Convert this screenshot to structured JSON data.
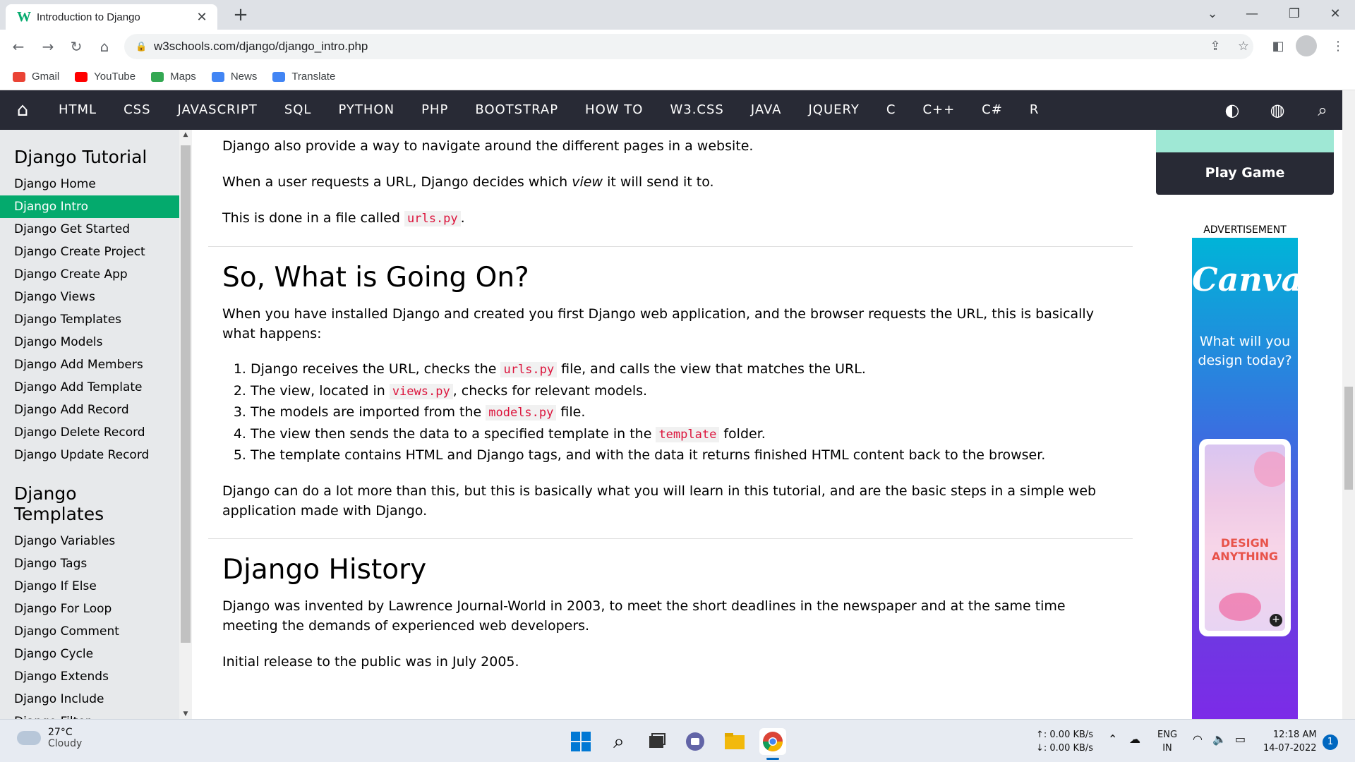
{
  "browser": {
    "tab_title": "Introduction to Django",
    "tab_favicon": "W",
    "url": "w3schools.com/django/django_intro.php"
  },
  "bookmarks": [
    {
      "label": "Gmail",
      "color": "#ea4335"
    },
    {
      "label": "YouTube",
      "color": "#ff0000"
    },
    {
      "label": "Maps",
      "color": "#34a853"
    },
    {
      "label": "News",
      "color": "#4285f4"
    },
    {
      "label": "Translate",
      "color": "#4285f4"
    }
  ],
  "topnav": {
    "items": [
      "HTML",
      "CSS",
      "JAVASCRIPT",
      "SQL",
      "PYTHON",
      "PHP",
      "BOOTSTRAP",
      "HOW TO",
      "W3.CSS",
      "JAVA",
      "JQUERY",
      "C",
      "C++",
      "C#",
      "R"
    ]
  },
  "sidebar": {
    "section1_title": "Django Tutorial",
    "section1_items": [
      "Django Home",
      "Django Intro",
      "Django Get Started",
      "Django Create Project",
      "Django Create App",
      "Django Views",
      "Django Templates",
      "Django Models",
      "Django Add Members",
      "Django Add Template",
      "Django Add Record",
      "Django Delete Record",
      "Django Update Record"
    ],
    "active_item": "Django Intro",
    "section2_title": "Django Templates",
    "section2_items": [
      "Django Variables",
      "Django Tags",
      "Django If Else",
      "Django For Loop",
      "Django Comment",
      "Django Cycle",
      "Django Extends",
      "Django Include",
      "Django Filter"
    ]
  },
  "main": {
    "p1": "Django also provide a way to navigate around the different pages in a website.",
    "p2_a": "When a user requests a URL, Django decides which ",
    "p2_em": "view",
    "p2_b": " it will send it to.",
    "p3_a": "This is done in a file called ",
    "p3_code": "urls.py",
    "p3_b": ".",
    "h2_going_on": "So, What is Going On?",
    "p4": "When you have installed Django and created you first Django web application, and the browser requests the URL, this is basically what happens:",
    "list": [
      {
        "a": "Django receives the URL, checks the ",
        "code": "urls.py",
        "b": " file, and calls the view that matches the URL."
      },
      {
        "a": "The view, located in ",
        "code": "views.py",
        "b": ", checks for relevant models."
      },
      {
        "a": "The models are imported from the ",
        "code": "models.py",
        "b": " file."
      },
      {
        "a": "The view then sends the data to a specified template in the ",
        "code": "template",
        "b": " folder."
      },
      {
        "a": "The template contains HTML and Django tags, and with the data it returns finished HTML content back to the browser.",
        "code": "",
        "b": ""
      }
    ],
    "p5": "Django can do a lot more than this, but this is basically what you will learn in this tutorial, and are the basic steps in a simple web application made with Django.",
    "h2_history": "Django History",
    "p6": "Django was invented by Lawrence Journal-World in 2003, to meet the short deadlines in the newspaper and at the same time meeting the demands of experienced web developers.",
    "p7": "Initial release to the public was in July 2005."
  },
  "right": {
    "play_button": "Play Game",
    "ad_label": "ADVERTISEMENT",
    "ad_logo": "Canva",
    "ad_tagline": "What will you design today?",
    "ad_screen_text": "DESIGN ANYTHING"
  },
  "taskbar": {
    "temp": "27°C",
    "condition": "Cloudy",
    "net_up": "↑: 0.00 KB/s",
    "net_down": "↓: 0.00 KB/s",
    "lang1": "ENG",
    "lang2": "IN",
    "time": "12:18 AM",
    "date": "14-07-2022",
    "notif_count": "1"
  }
}
